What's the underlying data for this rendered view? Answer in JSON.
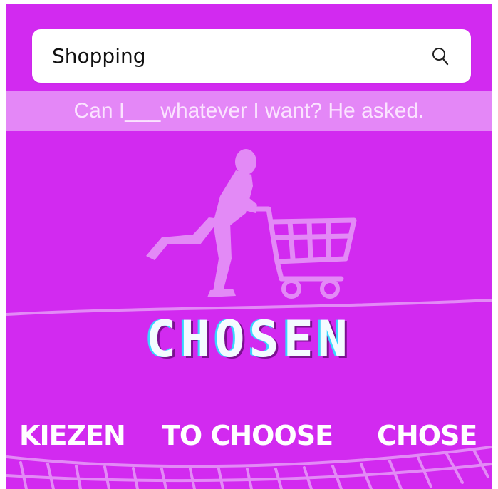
{
  "search": {
    "value": "Shopping",
    "icon": "search-icon"
  },
  "prompt": {
    "text": "Can I___whatever I want? He asked."
  },
  "title": {
    "word": "CHOSEN"
  },
  "forms": {
    "items": [
      "KIEZEN",
      "TO CHOOSE",
      "CHOSE"
    ]
  },
  "colors": {
    "background": "#d22af0",
    "strip": "#e487f7",
    "illustration": "#e38af6",
    "title_glow": "#39d6ff"
  }
}
